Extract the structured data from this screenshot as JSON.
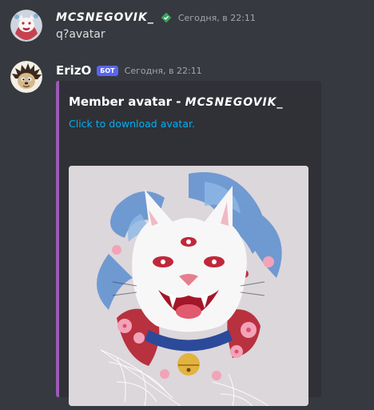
{
  "messages": [
    {
      "username": "MCSNEGOVIK_",
      "timestamp": "Сегодня, в 22:11",
      "content": "q?avatar",
      "avatar_icon": "white-cat-avatar-icon",
      "verified_icon": "verified-badge-icon"
    },
    {
      "username": "ErizO",
      "bot_tag": "БОТ",
      "timestamp": "Сегодня, в 22:11",
      "avatar_icon": "hedgehog-avatar-icon",
      "embed": {
        "title_prefix": "Member avatar - ",
        "title_name": "MCSNEGOVIK_",
        "link_text": "Click to download avatar.",
        "border_color": "#9b59b6",
        "image_icon": "white-cat-artwork-image"
      }
    }
  ],
  "colors": {
    "background": "#36393f",
    "embed_background": "#2f3136",
    "link": "#00aff4",
    "bot_tag": "#5865f2",
    "verified": "#3ba55d"
  }
}
